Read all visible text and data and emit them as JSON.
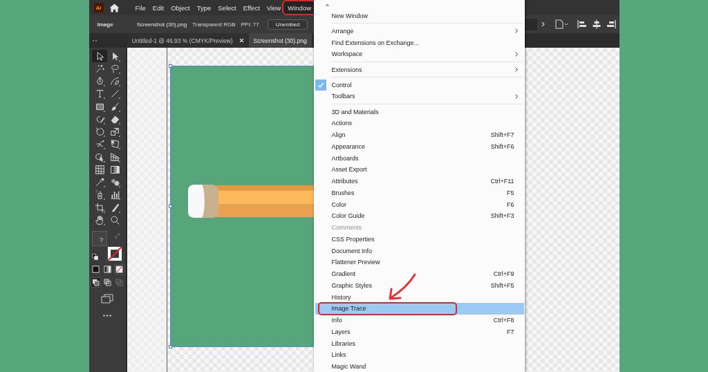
{
  "logo": "Ai",
  "menu_bar": [
    {
      "label": "File",
      "selected": false,
      "circled": false
    },
    {
      "label": "Edit",
      "selected": false,
      "circled": false
    },
    {
      "label": "Object",
      "selected": false,
      "circled": false
    },
    {
      "label": "Type",
      "selected": false,
      "circled": false
    },
    {
      "label": "Select",
      "selected": false,
      "circled": false
    },
    {
      "label": "Effect",
      "selected": false,
      "circled": false
    },
    {
      "label": "View",
      "selected": false,
      "circled": false
    },
    {
      "label": "Window",
      "selected": true,
      "circled": true
    }
  ],
  "control_bar": {
    "object_type": "Image",
    "file_link": "Screenshot (30).png",
    "color_mode": "Transparent RGB",
    "ppi": "PPI: 77",
    "button": "Unembed"
  },
  "document_tabs": [
    {
      "label": "Untitled-1 @ 46.93 % (CMYK/Preview)",
      "selected": false,
      "close_button": true
    },
    {
      "label": "Screenshot (30).png",
      "selected": true,
      "close_button": false
    }
  ],
  "toolbar": {
    "tools": [
      {
        "kind": "selection",
        "selected": true
      },
      {
        "kind": "direct",
        "selected": false
      },
      {
        "kind": "wand",
        "selected": false
      },
      {
        "kind": "lasso",
        "selected": false
      },
      {
        "kind": "pen",
        "selected": false
      },
      {
        "kind": "curvature",
        "selected": false
      },
      {
        "kind": "type",
        "selected": false
      },
      {
        "kind": "line",
        "selected": false
      },
      {
        "kind": "rectangle",
        "selected": false
      },
      {
        "kind": "brush",
        "selected": false
      },
      {
        "kind": "shaper",
        "selected": false
      },
      {
        "kind": "eraser",
        "selected": false
      },
      {
        "kind": "rotate",
        "selected": false
      },
      {
        "kind": "scale",
        "selected": false
      },
      {
        "kind": "warp",
        "selected": false
      },
      {
        "kind": "transform",
        "selected": false
      },
      {
        "kind": "builder",
        "selected": false
      },
      {
        "kind": "perspective",
        "selected": false
      },
      {
        "kind": "mesh",
        "selected": false
      },
      {
        "kind": "gradient",
        "selected": false
      },
      {
        "kind": "eyedropper",
        "selected": false
      },
      {
        "kind": "blend",
        "selected": false
      },
      {
        "kind": "sprayer",
        "selected": false
      },
      {
        "kind": "graph",
        "selected": false
      },
      {
        "kind": "artboard",
        "selected": false
      },
      {
        "kind": "slice",
        "selected": false
      },
      {
        "kind": "hand",
        "selected": false
      },
      {
        "kind": "zoom",
        "selected": false
      }
    ],
    "fill_mark": "?",
    "color_modes": [
      {
        "kind": "color",
        "selected": false
      },
      {
        "kind": "gradient",
        "selected": false
      },
      {
        "kind": "none",
        "selected": true
      }
    ],
    "draw_modes": [
      {
        "kind": "normal",
        "selected": true
      },
      {
        "kind": "behind",
        "selected": false
      },
      {
        "kind": "inside",
        "selected": false
      }
    ]
  },
  "window_menu": {
    "groups": [
      [
        {
          "label": "New Window",
          "submenu": false,
          "checked": false,
          "disabled": false,
          "highlighted": false,
          "circled": false
        }
      ],
      [
        {
          "label": "Arrange",
          "submenu": true,
          "checked": false,
          "disabled": false,
          "highlighted": false,
          "circled": false
        },
        {
          "label": "Find Extensions on Exchange...",
          "submenu": false,
          "checked": false,
          "disabled": false,
          "highlighted": false,
          "circled": false
        },
        {
          "label": "Workspace",
          "submenu": true,
          "checked": false,
          "disabled": false,
          "highlighted": false,
          "circled": false
        }
      ],
      [
        {
          "label": "Extensions",
          "submenu": true,
          "checked": false,
          "disabled": false,
          "highlighted": false,
          "circled": false
        }
      ],
      [
        {
          "label": "Control",
          "submenu": false,
          "checked": true,
          "disabled": false,
          "highlighted": false,
          "circled": false
        },
        {
          "label": "Toolbars",
          "submenu": true,
          "checked": false,
          "disabled": false,
          "highlighted": false,
          "circled": false
        }
      ],
      [
        {
          "label": "3D and Materials",
          "submenu": false,
          "checked": false,
          "disabled": false,
          "highlighted": false,
          "circled": false
        },
        {
          "label": "Actions",
          "submenu": false,
          "checked": false,
          "disabled": false,
          "highlighted": false,
          "circled": false
        },
        {
          "label": "Align",
          "shortcut": "Shift+F7",
          "submenu": false,
          "checked": false,
          "disabled": false,
          "highlighted": false,
          "circled": false
        },
        {
          "label": "Appearance",
          "shortcut": "Shift+F6",
          "submenu": false,
          "checked": false,
          "disabled": false,
          "highlighted": false,
          "circled": false
        },
        {
          "label": "Artboards",
          "submenu": false,
          "checked": false,
          "disabled": false,
          "highlighted": false,
          "circled": false
        },
        {
          "label": "Asset Export",
          "submenu": false,
          "checked": false,
          "disabled": false,
          "highlighted": false,
          "circled": false
        },
        {
          "label": "Attributes",
          "shortcut": "Ctrl+F11",
          "submenu": false,
          "checked": false,
          "disabled": false,
          "highlighted": false,
          "circled": false
        },
        {
          "label": "Brushes",
          "shortcut": "F5",
          "submenu": false,
          "checked": false,
          "disabled": false,
          "highlighted": false,
          "circled": false
        },
        {
          "label": "Color",
          "shortcut": "F6",
          "submenu": false,
          "checked": false,
          "disabled": false,
          "highlighted": false,
          "circled": false
        },
        {
          "label": "Color Guide",
          "shortcut": "Shift+F3",
          "submenu": false,
          "checked": false,
          "disabled": false,
          "highlighted": false,
          "circled": false
        },
        {
          "label": "Comments",
          "submenu": false,
          "checked": false,
          "disabled": true,
          "highlighted": false,
          "circled": false
        },
        {
          "label": "CSS Properties",
          "submenu": false,
          "checked": false,
          "disabled": false,
          "highlighted": false,
          "circled": false
        },
        {
          "label": "Document Info",
          "submenu": false,
          "checked": false,
          "disabled": false,
          "highlighted": false,
          "circled": false
        },
        {
          "label": "Flattener Preview",
          "submenu": false,
          "checked": false,
          "disabled": false,
          "highlighted": false,
          "circled": false
        },
        {
          "label": "Gradient",
          "shortcut": "Ctrl+F9",
          "submenu": false,
          "checked": false,
          "disabled": false,
          "highlighted": false,
          "circled": false
        },
        {
          "label": "Graphic Styles",
          "shortcut": "Shift+F5",
          "submenu": false,
          "checked": false,
          "disabled": false,
          "highlighted": false,
          "circled": false
        },
        {
          "label": "History",
          "submenu": false,
          "checked": false,
          "disabled": false,
          "highlighted": false,
          "circled": false
        },
        {
          "label": "Image Trace",
          "submenu": false,
          "checked": false,
          "disabled": false,
          "highlighted": true,
          "circled": true
        },
        {
          "label": "Info",
          "shortcut": "Ctrl+F8",
          "submenu": false,
          "checked": false,
          "disabled": false,
          "highlighted": false,
          "circled": false
        },
        {
          "label": "Layers",
          "shortcut": "F7",
          "submenu": false,
          "checked": false,
          "disabled": false,
          "highlighted": false,
          "circled": false
        },
        {
          "label": "Libraries",
          "submenu": false,
          "checked": false,
          "disabled": false,
          "highlighted": false,
          "circled": false
        },
        {
          "label": "Links",
          "submenu": false,
          "checked": false,
          "disabled": false,
          "highlighted": false,
          "circled": false
        },
        {
          "label": "Magic Wand",
          "submenu": false,
          "checked": false,
          "disabled": false,
          "highlighted": false,
          "circled": false
        }
      ]
    ]
  }
}
